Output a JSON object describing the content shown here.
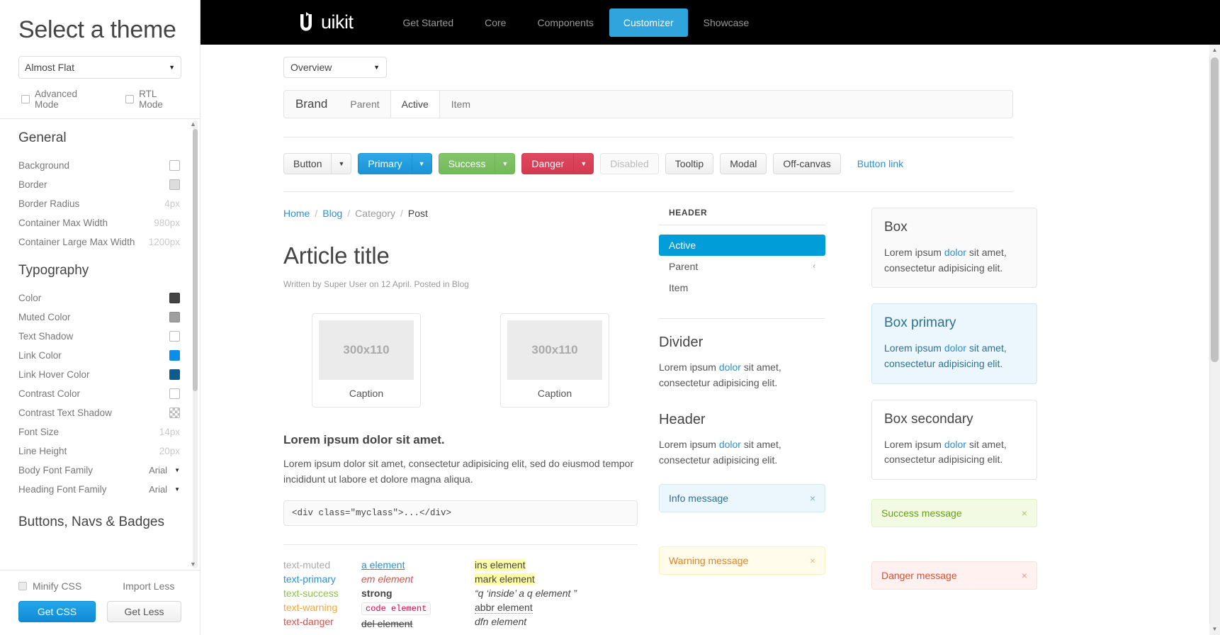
{
  "customizer": {
    "title": "Select a theme",
    "theme_select": {
      "value": "Almost Flat",
      "caret": "chevron-down-icon"
    },
    "modes": [
      {
        "label": "Advanced Mode",
        "checked": false
      },
      {
        "label": "RTL Mode",
        "checked": false
      }
    ],
    "groups": [
      {
        "title": "General",
        "rows": [
          {
            "label": "Background",
            "type": "color",
            "value": "#ffffff"
          },
          {
            "label": "Border",
            "type": "color",
            "value": "#dddddd"
          },
          {
            "label": "Border Radius",
            "type": "text",
            "value": "4px"
          },
          {
            "label": "Container Max Width",
            "type": "text",
            "value": "980px"
          },
          {
            "label": "Container Large Max Width",
            "type": "text",
            "value": "1200px"
          }
        ]
      },
      {
        "title": "Typography",
        "rows": [
          {
            "label": "Color",
            "type": "color",
            "value": "#444444"
          },
          {
            "label": "Muted Color",
            "type": "color",
            "value": "#9f9f9f"
          },
          {
            "label": "Text Shadow",
            "type": "color",
            "value": "#ffffff"
          },
          {
            "label": "Link Color",
            "type": "color",
            "value": "#0b8ee8"
          },
          {
            "label": "Link Hover Color",
            "type": "color",
            "value": "#0d5c8f"
          },
          {
            "label": "Contrast Color",
            "type": "color",
            "value": "#ffffff"
          },
          {
            "label": "Contrast Text Shadow",
            "type": "checker",
            "value": "transparent"
          },
          {
            "label": "Font Size",
            "type": "text",
            "value": "14px"
          },
          {
            "label": "Line Height",
            "type": "text",
            "value": "20px"
          },
          {
            "label": "Body Font Family",
            "type": "font",
            "value": "Arial"
          },
          {
            "label": "Heading Font Family",
            "type": "font",
            "value": "Arial"
          }
        ]
      },
      {
        "title": "Buttons, Navs & Badges",
        "rows": []
      }
    ],
    "footer": {
      "minify_label": "Minify CSS",
      "minify_checked": false,
      "import_less_label": "Import Less",
      "get_css_label": "Get CSS",
      "get_less_label": "Get Less"
    }
  },
  "navbar": {
    "brand": "uikit",
    "brand_icon": "uikit-logo-icon",
    "links": [
      {
        "label": "Get Started",
        "active": false
      },
      {
        "label": "Core",
        "active": false
      },
      {
        "label": "Components",
        "active": false
      },
      {
        "label": "Customizer",
        "active": true
      },
      {
        "label": "Showcase",
        "active": false
      }
    ]
  },
  "preview": {
    "section_select": {
      "value": "Overview",
      "caret": "chevron-down-icon"
    },
    "demo_navbar": {
      "brand": "Brand",
      "items": [
        {
          "label": "Parent",
          "active": false
        },
        {
          "label": "Active",
          "active": true
        },
        {
          "label": "Item",
          "active": false
        }
      ]
    },
    "buttons": [
      {
        "label": "Button",
        "style": "default",
        "split": true
      },
      {
        "label": "Primary",
        "style": "primary",
        "split": true
      },
      {
        "label": "Success",
        "style": "success",
        "split": true
      },
      {
        "label": "Danger",
        "style": "danger",
        "split": true
      },
      {
        "label": "Disabled",
        "style": "disabled",
        "split": false
      },
      {
        "label": "Tooltip",
        "style": "default",
        "split": false
      },
      {
        "label": "Modal",
        "style": "default",
        "split": false
      },
      {
        "label": "Off-canvas",
        "style": "default",
        "split": false
      },
      {
        "label": "Button link",
        "style": "link",
        "split": false
      }
    ],
    "article": {
      "breadcrumb": [
        {
          "label": "Home",
          "kind": "link"
        },
        {
          "label": "Blog",
          "kind": "link"
        },
        {
          "label": "Category",
          "kind": "muted"
        },
        {
          "label": "Post",
          "kind": "current"
        }
      ],
      "breadcrumb_separator": "/",
      "title": "Article title",
      "meta": "Written by Super User on 12 April. Posted in Blog",
      "figures": [
        {
          "placeholder": "300x110",
          "caption": "Caption"
        },
        {
          "placeholder": "300x110",
          "caption": "Caption"
        }
      ],
      "heading": "Lorem ipsum dolor sit amet.",
      "paragraph": "Lorem ipsum dolor sit amet, consectetur adipisicing elit, sed do eiusmod tempor incididunt ut labore et dolore magna aliqua.",
      "code": "<div class=\"myclass\">...</div>",
      "text_columns": [
        [
          "text-muted",
          "text-primary",
          "text-success",
          "text-warning",
          "text-danger"
        ],
        [
          "a element",
          "em element",
          "strong",
          "code element",
          "del element"
        ],
        [
          "ins element",
          "mark element",
          "“q ‘inside’ a q element ”",
          "abbr element",
          "dfn element"
        ]
      ]
    },
    "sidebar": {
      "nav_header": "HEADER",
      "nav_items": [
        {
          "label": "Active",
          "active": true,
          "chevron": ""
        },
        {
          "label": "Parent",
          "active": false,
          "chevron": "‹"
        },
        {
          "label": "Item",
          "active": false,
          "chevron": ""
        }
      ],
      "divider_heading": "Divider",
      "divider_text_a": "Lorem ipsum ",
      "divider_link": "dolor",
      "divider_text_b": " sit amet, consectetur adipisicing elit.",
      "header_heading": "Header",
      "header_text_a": "Lorem ipsum ",
      "header_link": "dolor",
      "header_text_b": " sit amet, consectetur adipisicing elit.",
      "alerts": [
        {
          "label": "Info message",
          "style": "info",
          "close": "×"
        },
        {
          "label": "Warning message",
          "style": "warning",
          "close": "×"
        }
      ]
    },
    "boxes": [
      {
        "title": "Box",
        "style": "default",
        "text_a": "Lorem ipsum ",
        "link": "dolor",
        "text_b": " sit amet, consectetur adipisicing elit."
      },
      {
        "title": "Box primary",
        "style": "primary",
        "text_a": "Lorem ipsum ",
        "link": "dolor",
        "text_b": " sit amet, consectetur adipisicing elit."
      },
      {
        "title": "Box secondary",
        "style": "secondary",
        "text_a": "Lorem ipsum ",
        "link": "dolor",
        "text_b": " sit amet, consectetur adipisicing elit."
      }
    ],
    "right_alerts": [
      {
        "label": "Success message",
        "style": "success",
        "close": "×"
      },
      {
        "label": "Danger message",
        "style": "danger",
        "close": "×"
      }
    ]
  },
  "colors": {
    "accent": "#2fa4dd",
    "link": "#2d8fd7",
    "nav_active": "#009dd8",
    "success": "#74b95b",
    "danger": "#d33a51"
  }
}
